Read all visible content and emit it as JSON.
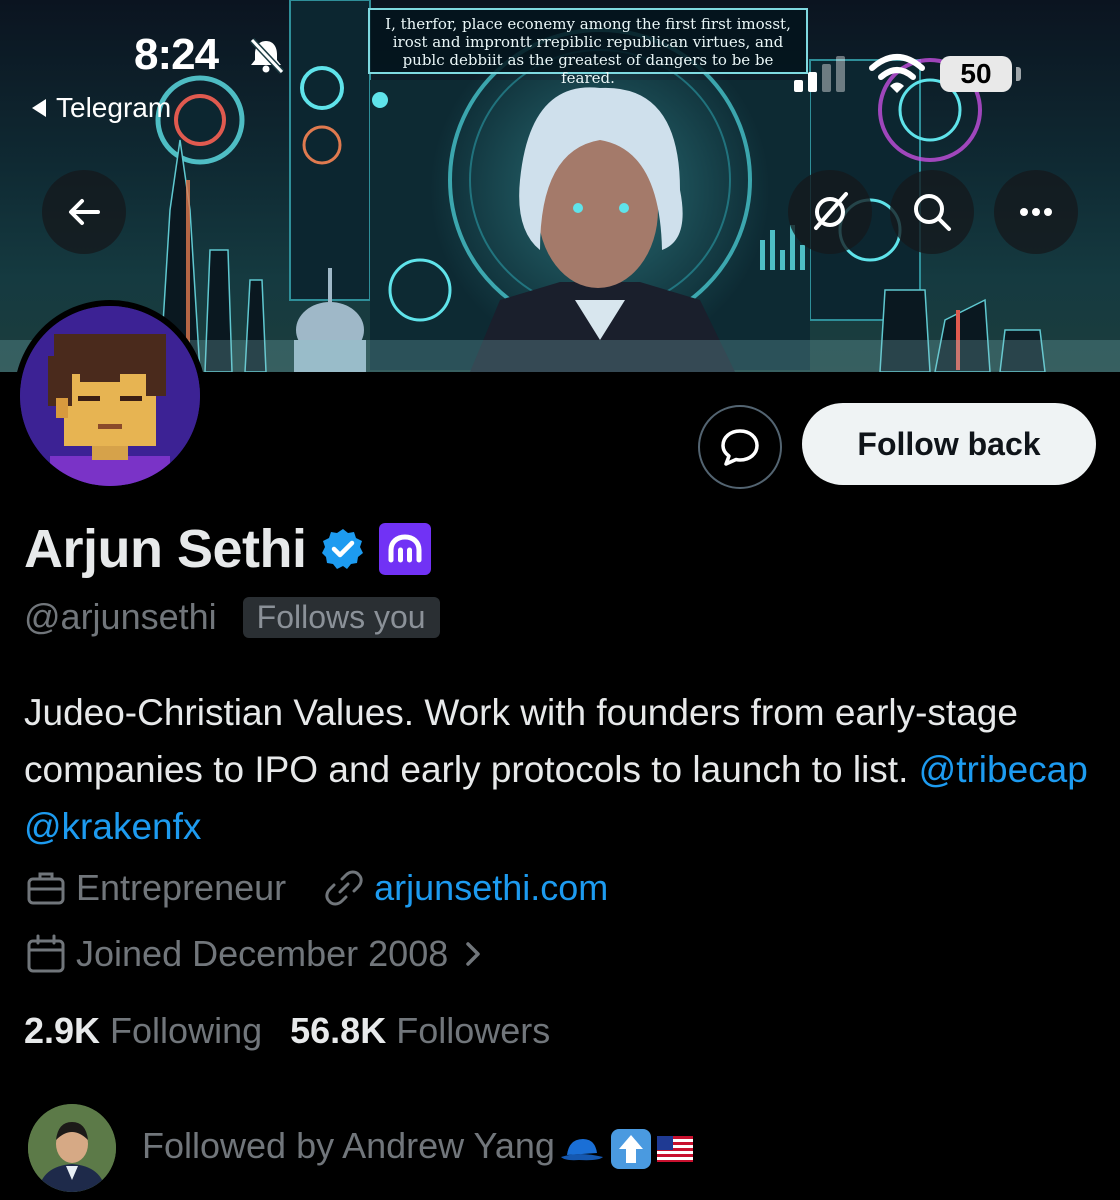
{
  "status_bar": {
    "time": "8:24",
    "back_app": "Telegram",
    "battery": "50"
  },
  "banner": {
    "quote_line1": "I, therfor, place econemy among the first first imosst,",
    "quote_line2": "irost and improntt rrepiblic republican virtues, and",
    "quote_line3": "publc debbiit as the greatest of dangers to be be feared."
  },
  "header_buttons": {
    "back": "back-arrow-icon",
    "grok": "grok-icon",
    "search": "search-icon",
    "more": "more-icon"
  },
  "profile": {
    "name": "Arjun Sethi",
    "handle": "@arjunsethi",
    "follows_you": "Follows you",
    "bio_text": "Judeo-Christian Values. Work with founders from early-stage companies to IPO and early protocols to launch to list. ",
    "bio_mention1": "@tribecap",
    "bio_mention2": "@krakenfx",
    "category": "Entrepreneur",
    "website": "arjunsethi.com",
    "joined": "Joined December 2008",
    "following_count": "2.9K",
    "following_label": "Following",
    "followers_count": "56.8K",
    "followers_label": "Followers",
    "followed_by": "Followed by Andrew Yang"
  },
  "actions": {
    "follow_back": "Follow back"
  },
  "colors": {
    "accent": "#1d9bf0",
    "affiliate_badge": "#7132f5",
    "background": "#000000"
  }
}
